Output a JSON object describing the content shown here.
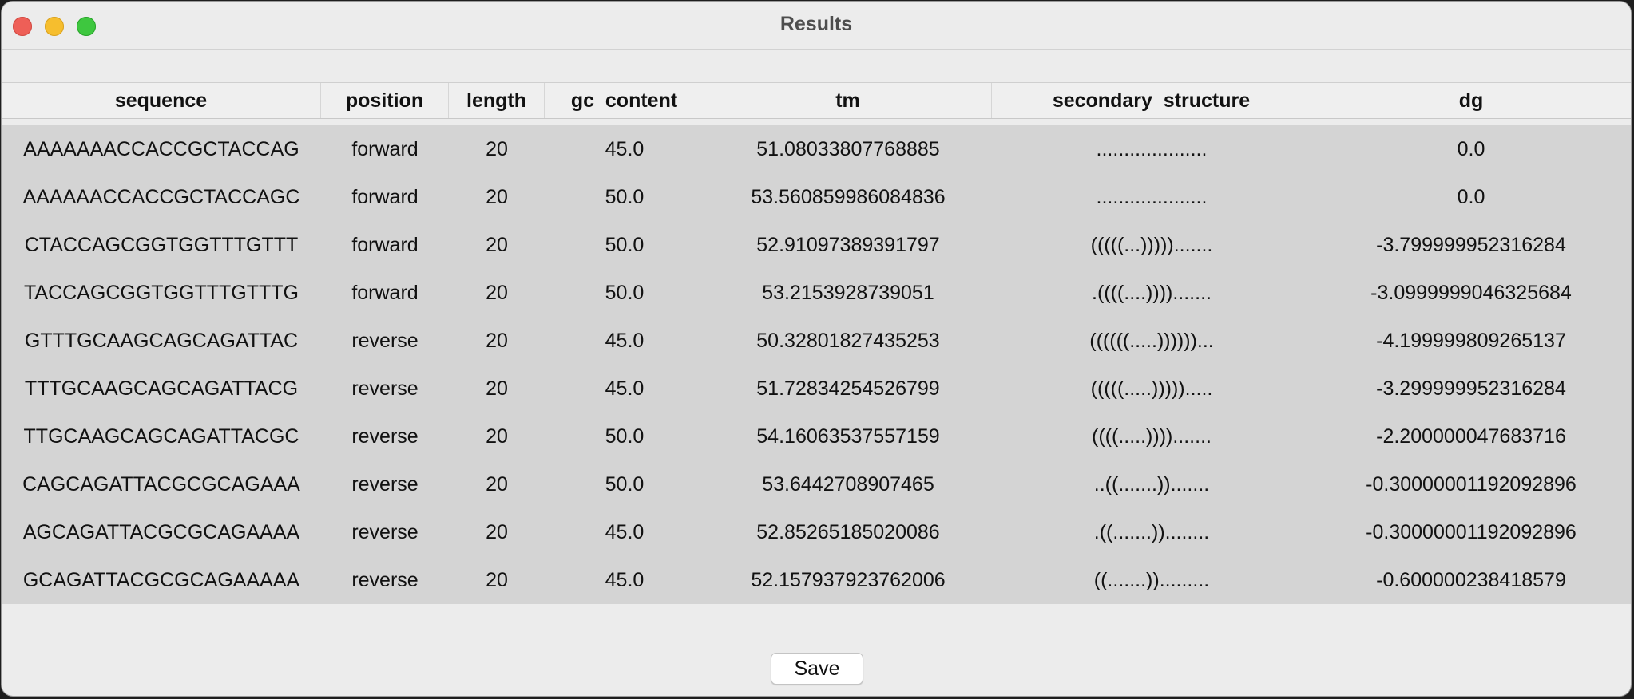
{
  "window": {
    "title": "Results"
  },
  "table": {
    "columns": [
      "sequence",
      "position",
      "length",
      "gc_content",
      "tm",
      "secondary_structure",
      "dg"
    ],
    "rows": [
      [
        "AAAAAAACCACCGCTACCAG",
        "forward",
        "20",
        "45.0",
        "51.08033807768885",
        "....................",
        "0.0"
      ],
      [
        "AAAAAACCACCGCTACCAGC",
        "forward",
        "20",
        "50.0",
        "53.560859986084836",
        "....................",
        "0.0"
      ],
      [
        "CTACCAGCGGTGGTTTGTTT",
        "forward",
        "20",
        "50.0",
        "52.91097389391797",
        "(((((...))))).......",
        "-3.799999952316284"
      ],
      [
        "TACCAGCGGTGGTTTGTTTG",
        "forward",
        "20",
        "50.0",
        "53.2153928739051",
        ".((((....)))).......",
        "-3.0999999046325684"
      ],
      [
        "GTTTGCAAGCAGCAGATTAC",
        "reverse",
        "20",
        "45.0",
        "50.32801827435253",
        "((((((.....))))))...",
        "-4.199999809265137"
      ],
      [
        "TTTGCAAGCAGCAGATTACG",
        "reverse",
        "20",
        "45.0",
        "51.72834254526799",
        "(((((.....))))).....",
        "-3.299999952316284"
      ],
      [
        "TTGCAAGCAGCAGATTACGC",
        "reverse",
        "20",
        "50.0",
        "54.16063537557159",
        "((((.....)))).......",
        "-2.200000047683716"
      ],
      [
        "CAGCAGATTACGCGCAGAAA",
        "reverse",
        "20",
        "50.0",
        "53.6442708907465",
        "..((.......)).......",
        "-0.30000001192092896"
      ],
      [
        "AGCAGATTACGCGCAGAAAA",
        "reverse",
        "20",
        "45.0",
        "52.85265185020086",
        ".((.......))........",
        "-0.30000001192092896"
      ],
      [
        "GCAGATTACGCGCAGAAAAA",
        "reverse",
        "20",
        "45.0",
        "52.157937923762006",
        "((.......)).........",
        "-0.600000238418579"
      ]
    ]
  },
  "footer": {
    "save_label": "Save"
  },
  "colors": {
    "close": "#ee5f57",
    "minimize": "#f6be2e",
    "maximize": "#3ec73f",
    "table_body": "#d4d4d4"
  }
}
